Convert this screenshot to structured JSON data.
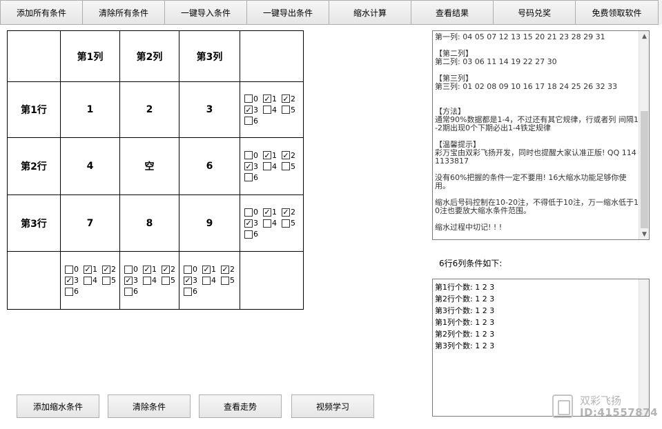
{
  "toolbar": {
    "buttons": [
      "添加所有条件",
      "清除所有条件",
      "一键导入条件",
      "一键导出条件",
      "缩水计算",
      "查看结果",
      "号码兑奖",
      "免费领取软件"
    ]
  },
  "grid": {
    "col_headers": [
      "第1列",
      "第2列",
      "第3列"
    ],
    "row_headers": [
      "第1行",
      "第2行",
      "第3行"
    ],
    "cells": [
      [
        "1",
        "2",
        "3"
      ],
      [
        "4",
        "空",
        "6"
      ],
      [
        "7",
        "8",
        "9"
      ]
    ],
    "checkbox_labels": [
      "0",
      "1",
      "2",
      "3",
      "4",
      "5",
      "6"
    ],
    "checked_marks": [
      "",
      "✓",
      "✓",
      "✓",
      "",
      "",
      ""
    ]
  },
  "info": {
    "text": "第一列: 04 05 07 12 13 15 20 21 23 28 29 31\n\n【第二列】\n第二列: 03 06 11 14 19 22 27 30\n\n【第三列】\n第三列: 01 02 08 09 10 16 17 18 24 25 26 32 33\n\n\n【方法】\n通常90%数据都是1-4，不过还有其它规律，行或者列 间隔1-2期出现0个下期必出1-4铁定规律\n\n【温馨提示】\n彩万宝由双彩飞扬开发，同时也提醒大家认准正版! QQ 1141133817\n\n没有60%把握的条件一定不要用! 16大缩水功能足够你使用。\n\n缩水后号码控制在10-20注，不得低于10注，万一缩水低于10注也要放大缩水条件范围。\n\n缩水过程中切记! ! !"
  },
  "conditions": {
    "label": "6行6列条件如下:",
    "lines": [
      "第1行个数: 1 2 3",
      "第2行个数: 1 2 3",
      "第3行个数: 1 2 3",
      "第1列个数: 1 2 3",
      "第2列个数: 1 2 3",
      "第3列个数: 1 2 3"
    ]
  },
  "bottom_buttons": [
    "添加缩水条件",
    "清除条件",
    "查看走势",
    "视频学习"
  ],
  "watermark": {
    "line1": "双彩飞扬",
    "line2": "ID:41557874"
  }
}
